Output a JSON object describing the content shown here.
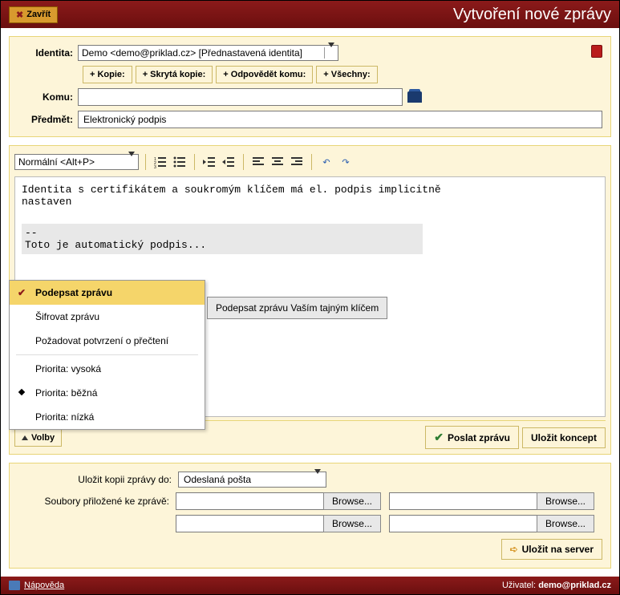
{
  "header": {
    "close": "Zavřít",
    "title": "Vytvoření nové zprávy"
  },
  "compose": {
    "identity_label": "Identita:",
    "identity_value": "Demo <demo@priklad.cz> [Přednastavená identita]",
    "btn_copy": "+ Kopie:",
    "btn_bcc": "+ Skrytá kopie:",
    "btn_replyto": "+ Odpovědět komu:",
    "btn_all": "+ Všechny:",
    "to_label": "Komu:",
    "to_value": "",
    "subject_label": "Předmět:",
    "subject_value": "Elektronický podpis"
  },
  "editor": {
    "format": "Normální <Alt+P>",
    "body_line1": "Identita s certifikátem a soukromým klíčem má el. podpis implicitně",
    "body_line2": "nastaven",
    "sig_sep": "--",
    "sig_text": "Toto je automatický podpis..."
  },
  "options_menu": {
    "sign": "Podepsat zprávu",
    "encrypt": "Šifrovat zprávu",
    "receipt": "Požadovat potvrzení o přečtení",
    "prio_high": "Priorita: vysoká",
    "prio_normal": "Priorita: běžná",
    "prio_low": "Priorita: nízká",
    "tooltip": "Podepsat zprávu Vaším tajným klíčem"
  },
  "actions": {
    "volby": "Volby",
    "send": "Poslat zprávu",
    "save_draft": "Uložit koncept"
  },
  "attach": {
    "save_copy_label": "Uložit kopii zprávy do:",
    "folder": "Odeslaná pošta",
    "files_label": "Soubory přiložené ke zprávě:",
    "browse": "Browse...",
    "save_server": "Uložit na server"
  },
  "footer": {
    "help": "Nápověda",
    "user_label": "Uživatel:",
    "user": "demo@priklad.cz"
  }
}
